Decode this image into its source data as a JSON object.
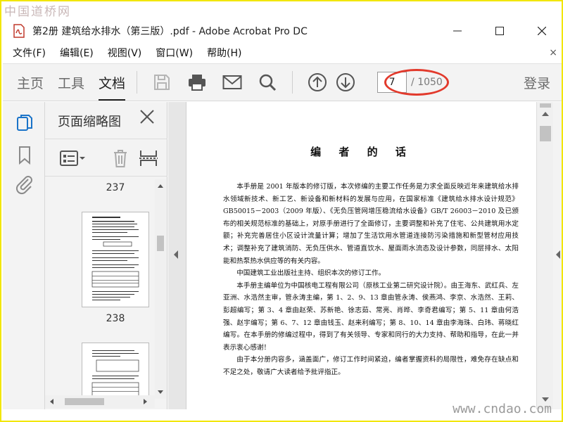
{
  "watermark": {
    "top": "中国道桥网",
    "bottom": "www.cndao.com"
  },
  "window": {
    "title": "第2册 建筑给水排水（第三版）.pdf - Adobe Acrobat Pro DC",
    "controls": {
      "minimize": "—",
      "maximize": "☐",
      "close": "✕"
    }
  },
  "menu": {
    "items": [
      "文件(F)",
      "编辑(E)",
      "视图(V)",
      "窗口(W)",
      "帮助(H)"
    ],
    "close": "×"
  },
  "toolbar": {
    "tabs": [
      "主页",
      "工具",
      "文档"
    ],
    "active_tab": "文档",
    "icons": [
      "save-icon",
      "print-icon",
      "email-icon",
      "search-icon",
      "page-up-icon",
      "page-down-icon"
    ],
    "current_page": "7",
    "total_pages": "/ 1050",
    "login": "登录",
    "highlight_color": "#e23a2c"
  },
  "sidebar": {
    "icons": [
      "page-thumbnails-icon",
      "bookmark-icon",
      "attachment-icon"
    ]
  },
  "thumbnails": {
    "title": "页面缩略图",
    "close": "✕",
    "tools": [
      "options-menu-icon",
      "delete-icon",
      "extract-pages-icon"
    ],
    "pages": [
      "237",
      "238"
    ]
  },
  "document": {
    "heading": "编 者 的 话",
    "paragraphs": [
      "本手册是 2001 年版本的修订版，本次修编的主要工作任务是力求全面反映近年来建筑给水排水领域新技术、新工艺、新设备和新材料的发展与应用，在国家标准《建筑给水排水设计规范》GB50015－2003（2009 年版）、《无负压管网增压稳流给水设备》GB/T 26003－2010 及已颁布的相关规范标准的基础上，对原手册进行了全面修订，主要调整和补充了住宅、公共建筑用水定额；补充完善居住小区设计流量计算；增加了生活饮用水管道连接防污染措施和新型管材应用技术；调整补充了建筑消防、无负压供水、管道直饮水、屋面雨水流态及设计参数，同层排水、太阳能和热泵热水供应等的有关内容。",
      "中国建筑工业出版社主持、组织本次的修订工作。",
      "本手册主编单位为中国核电工程有限公司（原核工业第二研究设计院）。由王海东、武红兵、左亚洲、水浩然主审，管永涛主编，第 1、2、9、13 章由管永涛、侯燕鸿、李京、水浩然、王莉、彭超编写；第 3、4 章由赵荣、苏新艳、徐志茹、常亮、肖晔、李奇君编写；第 5、11 章由何浩强、赵宇编写；第 6、7、12 章由钱玉、赵来利编写；第 8、10、14 章由李海珠、白玮、蒋晓红编写。在本手册的修编过程中，得到了有关领导、专家和同行的大力支持、帮助和指导，在此一并表示衷心感谢！",
      "由于本分册内容多，涵盖面广，修订工作时间紧迫，编者掌握资料的局限性，难免存在缺点和不足之处，敬请广大读者给予批评指正。"
    ]
  }
}
